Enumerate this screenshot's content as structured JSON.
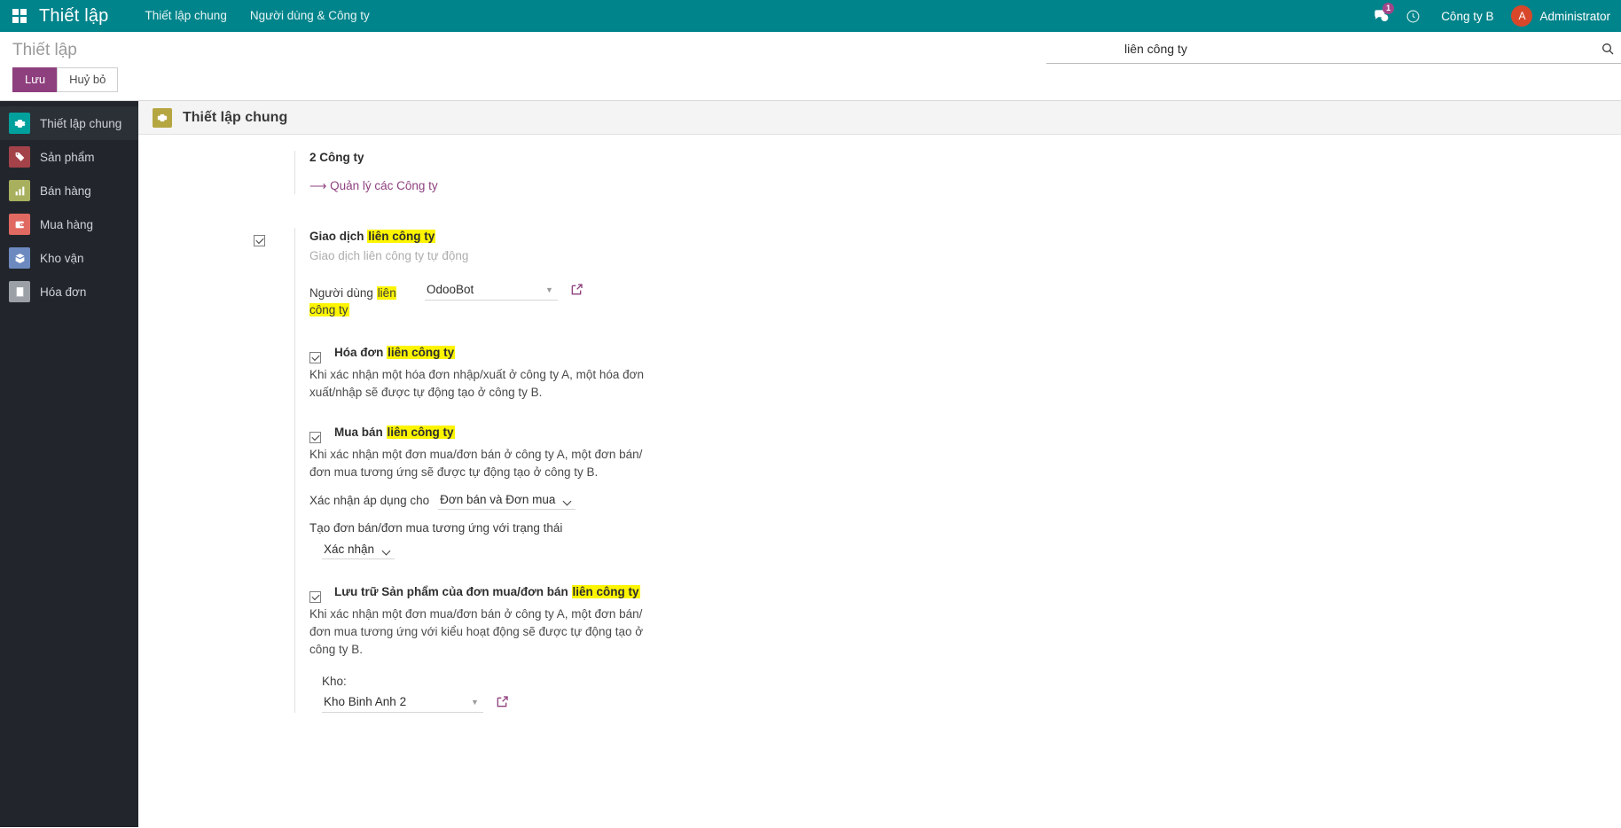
{
  "navbar": {
    "apps_icon": "apps-grid-icon",
    "brand": "Thiết lập",
    "menu_items": [
      {
        "label": "Thiết lập chung"
      },
      {
        "label": "Người dùng & Công ty"
      }
    ],
    "messages_icon": "chat-bubble-icon",
    "messages_badge": "1",
    "activity_icon": "clock-icon",
    "company": "Công ty B",
    "avatar_initial": "A",
    "user": "Administrator",
    "accent_color": "#00848b",
    "badge_color": "#a24689",
    "avatar_color": "#d9472b"
  },
  "control_panel": {
    "breadcrumb": "Thiết lập",
    "save_label": "Lưu",
    "discard_label": "Huỷ bỏ",
    "primary_color": "#8e3f7e"
  },
  "search": {
    "value": "liên công ty",
    "placeholder": "",
    "icon": "search-icon"
  },
  "sidebar": {
    "items": [
      {
        "label": "Thiết lập chung",
        "icon": "gear-icon",
        "color": "#00a09d",
        "active": true
      },
      {
        "label": "Sản phẩm",
        "icon": "tag-icon",
        "color": "#a4424a",
        "active": false
      },
      {
        "label": "Bán hàng",
        "icon": "chart-bar-icon",
        "color": "#a8b05e",
        "active": false
      },
      {
        "label": "Mua hàng",
        "icon": "wallet-icon",
        "color": "#e06a62",
        "active": false
      },
      {
        "label": "Kho vận",
        "icon": "box-icon",
        "color": "#6d8ac0",
        "active": false
      },
      {
        "label": "Hóa đơn",
        "icon": "invoice-icon",
        "color": "#9aa0a6",
        "active": false
      }
    ]
  },
  "main": {
    "section_title": "Thiết lập chung",
    "section_icon": "gear-icon",
    "companies": {
      "count_label": "2 Công ty",
      "manage_link": "Quản lý các Công ty",
      "arrow_icon": "arrow-right-icon"
    },
    "intercompany": {
      "checked": true,
      "title_prefix": "Giao dịch ",
      "title_highlight": "liên công ty",
      "subtitle": "Giao dịch liên công ty tự động",
      "user_field": {
        "label_prefix": "Người dùng ",
        "label_highlight": "liên công ty",
        "value": "OdooBot",
        "caret_icon": "chevron-down-icon",
        "external_icon": "external-link-icon"
      }
    },
    "invoice_block": {
      "checked": true,
      "title_prefix": "Hóa đơn ",
      "title_highlight": "liên công ty",
      "description": "Khi xác nhận một hóa đơn nhập/xuất ở công ty A, một hóa đơn xuất/nhập sẽ được tự động tạo ở công ty B."
    },
    "trade_block": {
      "checked": true,
      "title_prefix": "Mua bán ",
      "title_highlight": "liên công ty",
      "description": "Khi xác nhận một đơn mua/đơn bán ở công ty A, một đơn bán/đơn mua tương ứng sẽ được tự động tạo ở công ty B.",
      "apply_label": "Xác nhận áp dụng cho",
      "apply_value": "Đơn bán và Đơn mua",
      "apply_options": [
        "Đơn bán và Đơn mua"
      ],
      "state_label": "Tạo đơn bán/đơn mua tương ứng với trạng thái",
      "state_value": "Xác nhận",
      "state_options": [
        "Xác nhận"
      ]
    },
    "storage_block": {
      "checked": true,
      "title_prefix": "Lưu trữ Sản phẩm của đơn mua/đơn bán ",
      "title_highlight": "liên công ty",
      "description": "Khi xác nhận một đơn mua/đơn bán ở công ty A, một đơn bán/đơn mua tương ứng với kiểu hoạt động sẽ được tự động tạo ở công ty B.",
      "warehouse_label": "Kho:",
      "warehouse_value": "Kho Binh Anh 2",
      "caret_icon": "chevron-down-icon",
      "external_icon": "external-link-icon"
    }
  }
}
